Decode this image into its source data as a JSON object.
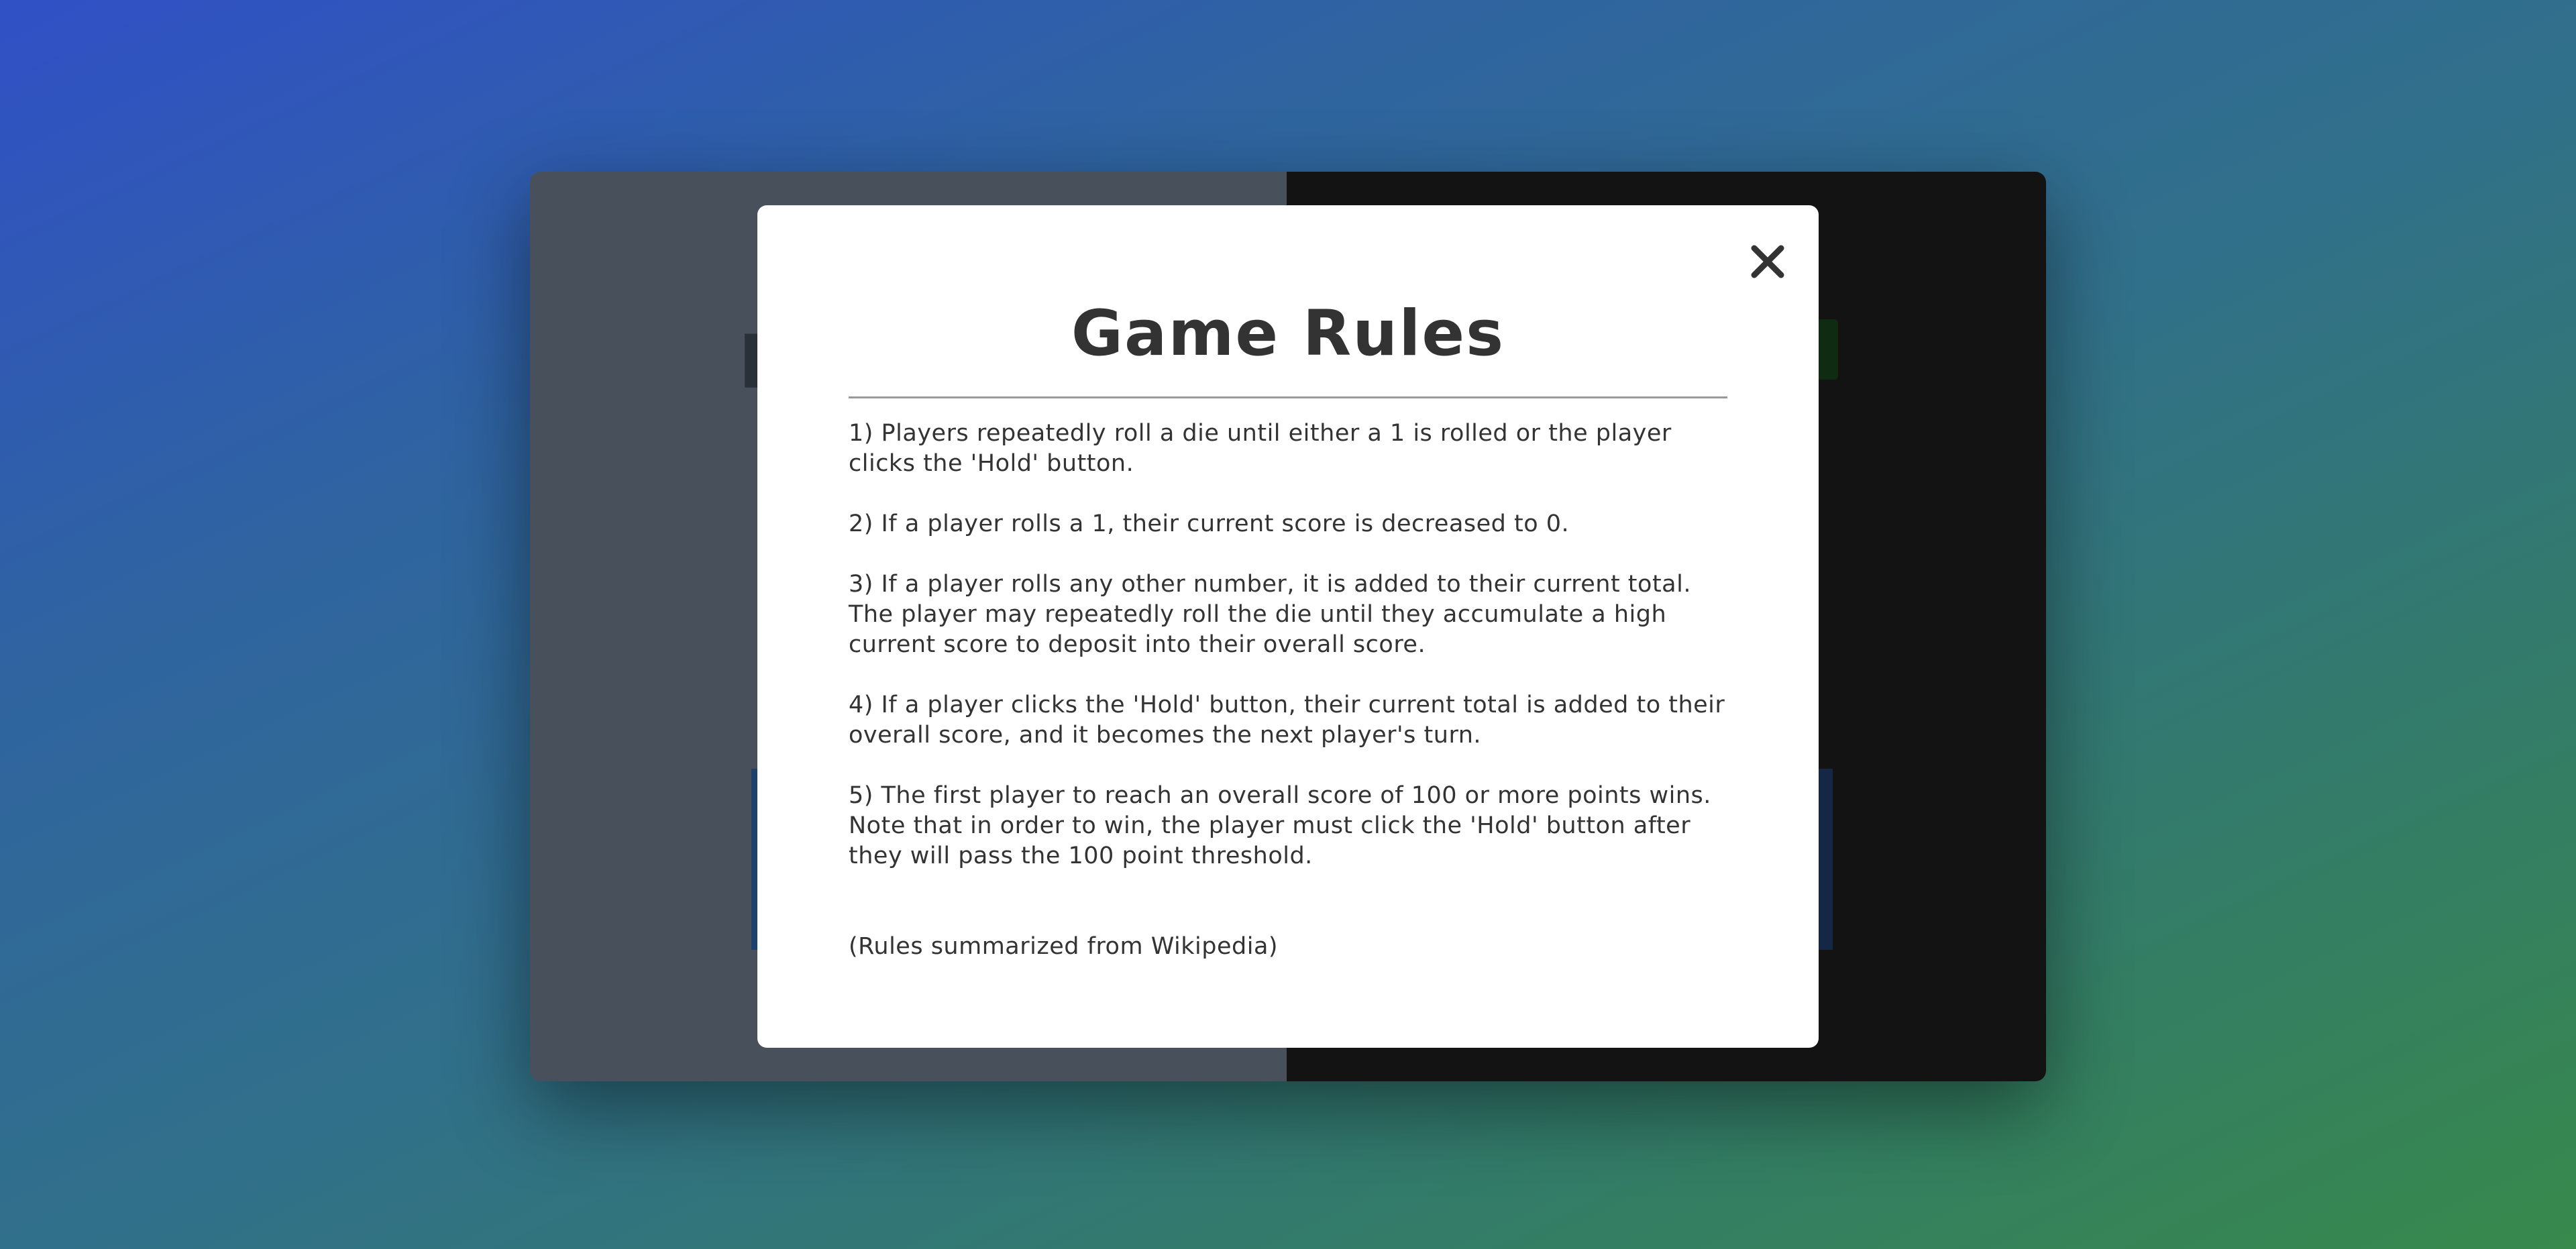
{
  "modal": {
    "title": "Game Rules",
    "close_icon": "close-icon",
    "rules": [
      "1) Players repeatedly roll a die until either a 1 is rolled or the player clicks the 'Hold' button.",
      "2) If a player rolls a 1, their current score is decreased to 0.",
      "3) If a player rolls any other number, it is added to their current total. The player may repeatedly roll the die until they accumulate a high current score to deposit into their overall score.",
      "4) If a player clicks the 'Hold' button, their current total is added to their overall score, and it becomes the next player's turn.",
      "5) The first player to reach an overall score of 100 or more points wins. Note that in order to win, the player must click the 'Hold' button after they will pass the 100 point threshold."
    ],
    "attribution": "(Rules summarized from Wikipedia)"
  },
  "colors": {
    "modal_background": "#ffffff",
    "text": "#333333",
    "left_panel": "#47505b",
    "right_panel": "#131313"
  }
}
